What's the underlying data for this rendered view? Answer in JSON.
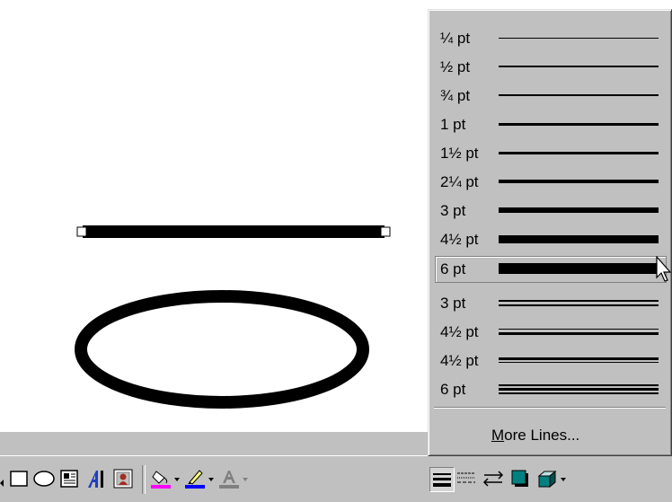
{
  "line_styles": [
    {
      "label": "¼ pt",
      "style": "single",
      "weight": 1
    },
    {
      "label": "½ pt",
      "style": "single",
      "weight": 1.5
    },
    {
      "label": "¾ pt",
      "style": "single",
      "weight": 2
    },
    {
      "label": "1 pt",
      "style": "single",
      "weight": 2.5
    },
    {
      "label": "1½ pt",
      "style": "single",
      "weight": 3
    },
    {
      "label": "2¼ pt",
      "style": "single",
      "weight": 4
    },
    {
      "label": "3 pt",
      "style": "single",
      "weight": 6
    },
    {
      "label": "4½ pt",
      "style": "single",
      "weight": 9
    },
    {
      "label": "6 pt",
      "style": "single",
      "weight": 12,
      "selected": true
    },
    {
      "label": "3 pt",
      "style": "double-equal"
    },
    {
      "label": "4½ pt",
      "style": "double-thin-thick"
    },
    {
      "label": "4½ pt",
      "style": "double-thick-thin"
    },
    {
      "label": "6 pt",
      "style": "triple"
    }
  ],
  "more_lines_label": "More Lines...",
  "more_lines_accesskey": "M",
  "toolbar": {
    "icons": [
      "rectangle-icon",
      "oval-icon",
      "text-box-icon",
      "wordart-icon",
      "clip-art-icon",
      "fill-color-icon",
      "line-color-icon",
      "font-color-icon",
      "line-style-icon",
      "dash-style-icon",
      "arrow-style-icon",
      "shadow-icon",
      "3d-icon"
    ],
    "fill_color": "#ff00ff",
    "line_color": "#0000ff",
    "font_color": "#808080"
  }
}
